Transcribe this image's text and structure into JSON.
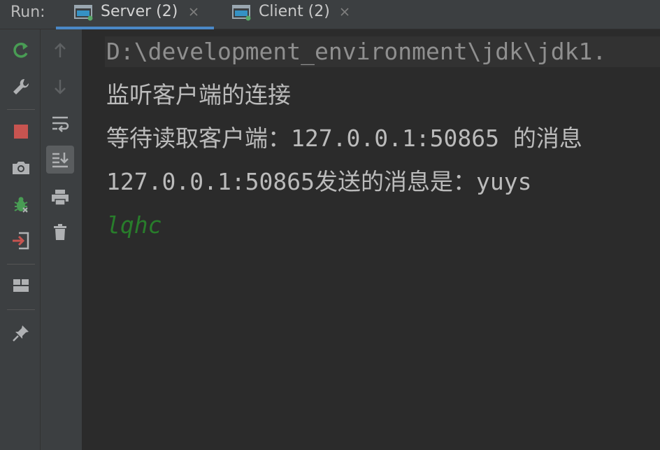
{
  "run_label": "Run:",
  "tabs": [
    {
      "label": "Server (2)",
      "active": true,
      "icon": "console-window-icon"
    },
    {
      "label": "Client (2)",
      "active": false,
      "icon": "console-window-icon"
    }
  ],
  "toolbar_left": [
    {
      "name": "rerun-icon"
    },
    {
      "name": "wrench-icon"
    },
    {
      "name": "stop-icon"
    },
    {
      "name": "camera-icon"
    },
    {
      "name": "debug-bug-icon"
    },
    {
      "name": "exit-icon"
    },
    {
      "name": "layout-icon"
    },
    {
      "name": "pin-icon"
    }
  ],
  "toolbar_right": [
    {
      "name": "up-arrow-icon"
    },
    {
      "name": "down-arrow-icon"
    },
    {
      "name": "soft-wrap-icon"
    },
    {
      "name": "scroll-to-end-icon",
      "pressed": true
    },
    {
      "name": "print-icon"
    },
    {
      "name": "trash-icon"
    }
  ],
  "console": {
    "command_line": "D:\\development_environment\\jdk\\jdk1.",
    "lines": [
      "监听客户端的连接",
      "等待读取客户端：127.0.0.1:50865 的消息",
      "127.0.0.1:50865发送的消息是：yuys",
      "lqhc"
    ]
  },
  "colors": {
    "background": "#2b2b2b",
    "panel": "#3c3f41",
    "accent_tab_underline": "#4a88c7",
    "user_input_green": "#287d2b",
    "stop_red": "#c75450",
    "run_green": "#499c54"
  }
}
